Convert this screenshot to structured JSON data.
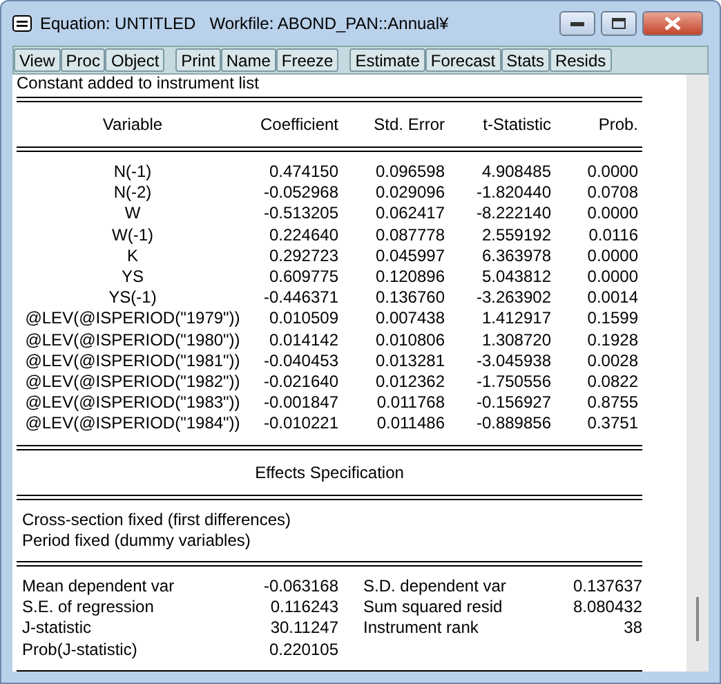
{
  "window": {
    "title": "Equation: UNTITLED   Workfile: ABOND_PAN::Annual¥"
  },
  "toolbar": [
    [
      "View",
      "Proc",
      "Object"
    ],
    [
      "Print",
      "Name",
      "Freeze"
    ],
    [
      "Estimate",
      "Forecast",
      "Stats",
      "Resids"
    ]
  ],
  "note": "Constant added to instrument list",
  "table": {
    "columns": [
      "Variable",
      "Coefficient",
      "Std. Error",
      "t-Statistic",
      "Prob."
    ],
    "rows": [
      [
        "N(-1)",
        "0.474150",
        "0.096598",
        "4.908485",
        "0.0000"
      ],
      [
        "N(-2)",
        "-0.052968",
        "0.029096",
        "-1.820440",
        "0.0708"
      ],
      [
        "W",
        "-0.513205",
        "0.062417",
        "-8.222140",
        "0.0000"
      ],
      [
        "W(-1)",
        "0.224640",
        "0.087778",
        "2.559192",
        "0.0116"
      ],
      [
        "K",
        "0.292723",
        "0.045997",
        "6.363978",
        "0.0000"
      ],
      [
        "YS",
        "0.609775",
        "0.120896",
        "5.043812",
        "0.0000"
      ],
      [
        "YS(-1)",
        "-0.446371",
        "0.136760",
        "-3.263902",
        "0.0014"
      ],
      [
        "@LEV(@ISPERIOD(\"1979\"))",
        "0.010509",
        "0.007438",
        "1.412917",
        "0.1599"
      ],
      [
        "@LEV(@ISPERIOD(\"1980\"))",
        "0.014142",
        "0.010806",
        "1.308720",
        "0.1928"
      ],
      [
        "@LEV(@ISPERIOD(\"1981\"))",
        "-0.040453",
        "0.013281",
        "-3.045938",
        "0.0028"
      ],
      [
        "@LEV(@ISPERIOD(\"1982\"))",
        "-0.021640",
        "0.012362",
        "-1.750556",
        "0.0822"
      ],
      [
        "@LEV(@ISPERIOD(\"1983\"))",
        "-0.001847",
        "0.011768",
        "-0.156927",
        "0.8755"
      ],
      [
        "@LEV(@ISPERIOD(\"1984\"))",
        "-0.010221",
        "0.011486",
        "-0.889856",
        "0.3751"
      ]
    ]
  },
  "effects": {
    "title": "Effects Specification",
    "lines": [
      "Cross-section fixed (first differences)",
      "Period fixed (dummy variables)"
    ]
  },
  "statistics": [
    [
      "Mean dependent var",
      "-0.063168",
      "S.D. dependent var",
      "0.137637"
    ],
    [
      "S.E. of regression",
      "0.116243",
      "Sum squared resid",
      "8.080432"
    ],
    [
      "J-statistic",
      "30.11247",
      "Instrument rank",
      "38"
    ],
    [
      "Prob(J-statistic)",
      "0.220105"
    ]
  ]
}
